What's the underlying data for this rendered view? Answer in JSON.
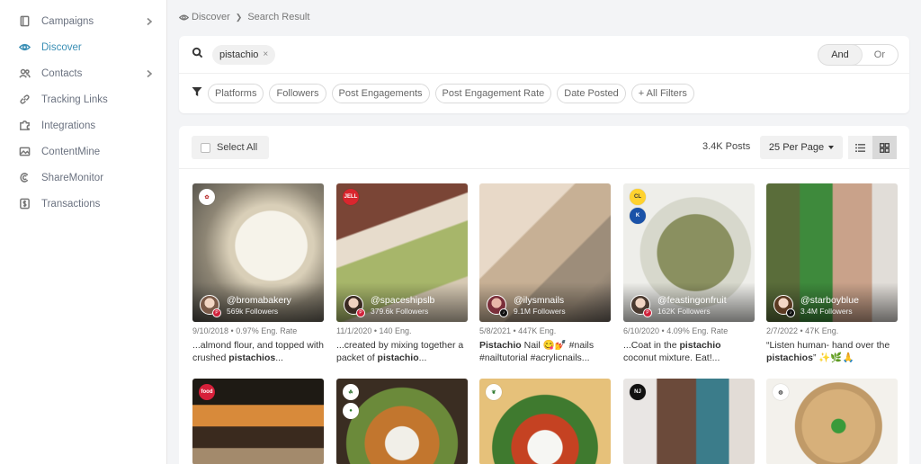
{
  "sidebar": {
    "items": [
      {
        "label": "Campaigns",
        "icon": "book-icon",
        "chevron": true
      },
      {
        "label": "Discover",
        "icon": "eye-icon",
        "active": true
      },
      {
        "label": "Contacts",
        "icon": "users-icon",
        "chevron": true
      },
      {
        "label": "Tracking Links",
        "icon": "link-icon"
      },
      {
        "label": "Integrations",
        "icon": "puzzle-icon"
      },
      {
        "label": "ContentMine",
        "icon": "image-icon"
      },
      {
        "label": "ShareMonitor",
        "icon": "copyright-icon"
      },
      {
        "label": "Transactions",
        "icon": "dollar-icon"
      }
    ],
    "accent": "#3b8fb5"
  },
  "breadcrumb": {
    "root": "Discover",
    "current": "Search Result"
  },
  "search": {
    "term": "pistachio",
    "remove_glyph": "×",
    "and_label": "And",
    "or_label": "Or"
  },
  "filters": {
    "items": [
      "Platforms",
      "Followers",
      "Post Engagements",
      "Post Engagement Rate",
      "Date Posted",
      "+ All Filters"
    ]
  },
  "results": {
    "select_all": "Select All",
    "count": "3.4K Posts",
    "per_page": "25 Per Page"
  },
  "posts": [
    {
      "handle": "@bromabakery",
      "followers": "569k Followers",
      "meta": "9/10/2018 • 0.97% Eng. Rate",
      "cap_pre": "...almond flour, and topped with crushed ",
      "cap_bold": "pistachios",
      "cap_post": "...",
      "platform": "pinterest",
      "brand": "bromabakery-logo"
    },
    {
      "handle": "@spaceshipslb",
      "followers": "379.6k Followers",
      "meta": "11/1/2020 • 140 Eng.",
      "cap_pre": "...created by mixing together a packet of ",
      "cap_bold": "pistachio",
      "cap_post": "...",
      "platform": "pinterest",
      "brand": "jello-logo"
    },
    {
      "handle": "@ilysmnails",
      "followers": "9.1M Followers",
      "meta": "5/8/2021 • 447K Eng.",
      "cap_pre": "",
      "cap_bold": "Pistachio",
      "cap_post": " Nail 😋💅 #nails #nailtutorial #acrylicnails...",
      "platform": "tiktok",
      "brand": ""
    },
    {
      "handle": "@feastingonfruit",
      "followers": "162K Followers",
      "meta": "6/10/2020 • 4.09% Eng. Rate",
      "cap_pre": "...Coat in the ",
      "cap_bold": "pistachio",
      "cap_post": " coconut mixture. Eat!...",
      "platform": "pinterest",
      "brand": "brand-logos"
    },
    {
      "handle": "@starboyblue",
      "followers": "3.4M Followers",
      "meta": "2/7/2022 • 47K Eng.",
      "cap_pre": "“Listen human- hand over the ",
      "cap_bold": "pistachios",
      "cap_post": "” ✨🌿🙏",
      "platform": "tiktok",
      "brand": ""
    }
  ]
}
